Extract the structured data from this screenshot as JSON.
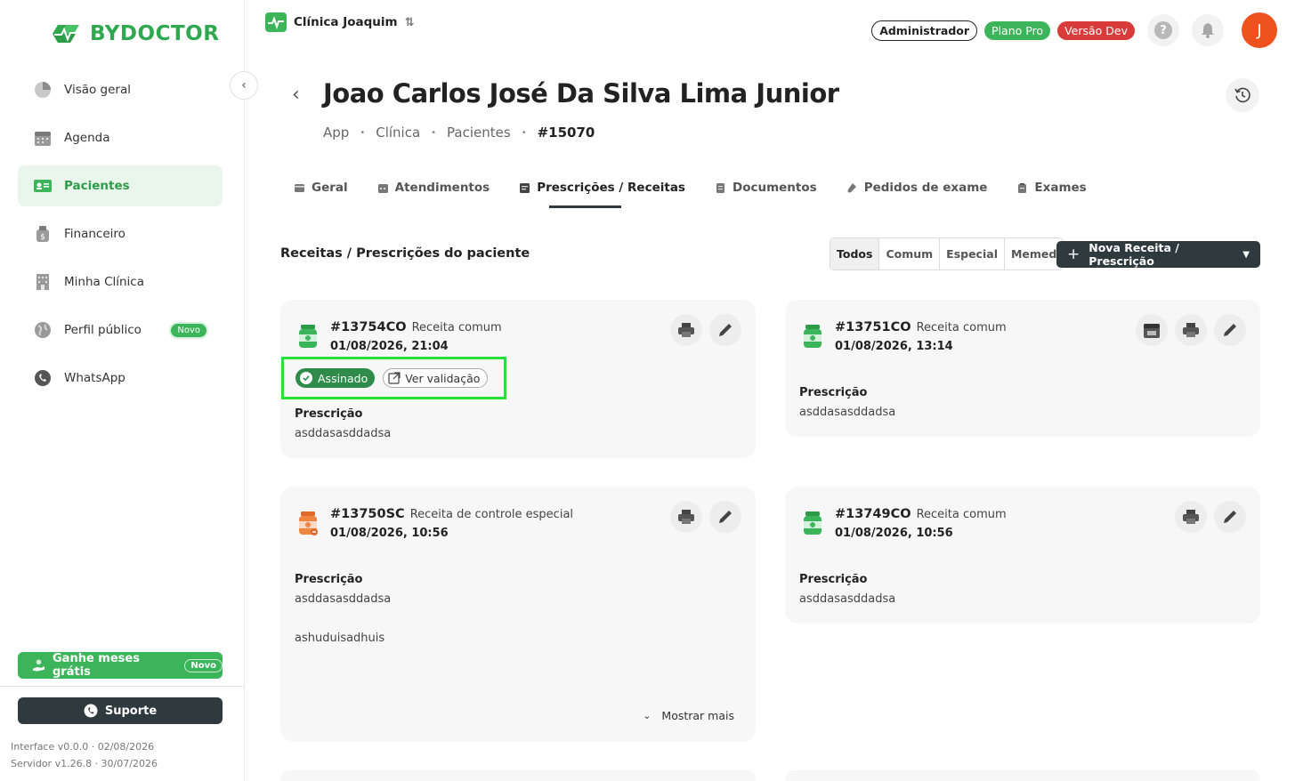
{
  "app": {
    "logo_text": "BYDOCTOR",
    "brand_color": "#3cb55a"
  },
  "sidebar": {
    "items": [
      {
        "label": "Visão geral",
        "icon": "pie-chart-icon"
      },
      {
        "label": "Agenda",
        "icon": "calendar-icon"
      },
      {
        "label": "Pacientes",
        "icon": "patients-icon",
        "active": true
      },
      {
        "label": "Financeiro",
        "icon": "money-bag-icon"
      },
      {
        "label": "Minha Clínica",
        "icon": "building-icon"
      },
      {
        "label": "Perfil público",
        "icon": "globe-icon",
        "badge": "Novo"
      },
      {
        "label": "WhatsApp",
        "icon": "whatsapp-icon"
      }
    ],
    "ganhe_label": "Ganhe meses grátis",
    "ganhe_badge": "Novo",
    "suporte_label": "Suporte",
    "version_interface": "Interface v0.0.0 · 02/08/2026",
    "version_server": "Servidor v1.26.8 · 30/07/2026"
  },
  "topbar": {
    "clinic_name": "Clínica Joaquim",
    "badge_admin": "Administrador",
    "badge_plan": "Plano Pro",
    "badge_version": "Versão Dev",
    "help_label": "?",
    "avatar_initial": "J"
  },
  "patient": {
    "name": "Joao Carlos José Da Silva Lima Junior",
    "breadcrumb": [
      "App",
      "Clínica",
      "Pacientes",
      "#15070"
    ]
  },
  "tabs": [
    "Geral",
    "Atendimentos",
    "Prescrições / Receitas",
    "Documentos",
    "Pedidos de exame",
    "Exames"
  ],
  "section": {
    "title": "Receitas / Prescrições do paciente",
    "filters": [
      "Todos",
      "Comum",
      "Especial",
      "Memed"
    ],
    "new_button": "Nova Receita / Prescrição"
  },
  "cards": [
    {
      "id": "#13754CO",
      "type": "Receita comum",
      "date": "01/08/2026, 21:04",
      "label": "Prescrição",
      "text": "asddasasddadsa",
      "signed": "Assinado",
      "validate": "Ver validação"
    },
    {
      "id": "#13751CO",
      "type": "Receita comum",
      "date": "01/08/2026, 13:14",
      "label": "Prescrição",
      "text": "asddasasddadsa"
    },
    {
      "id": "#13750SC",
      "type": "Receita de controle especial",
      "date": "01/08/2026, 10:56",
      "label": "Prescrição",
      "text": "asddasasddadsa",
      "text2": "ashuduisadhuis",
      "show_more": "Mostrar mais"
    },
    {
      "id": "#13749CO",
      "type": "Receita comum",
      "date": "01/08/2026, 10:56",
      "label": "Prescrição",
      "text": "asddasasddadsa"
    }
  ]
}
